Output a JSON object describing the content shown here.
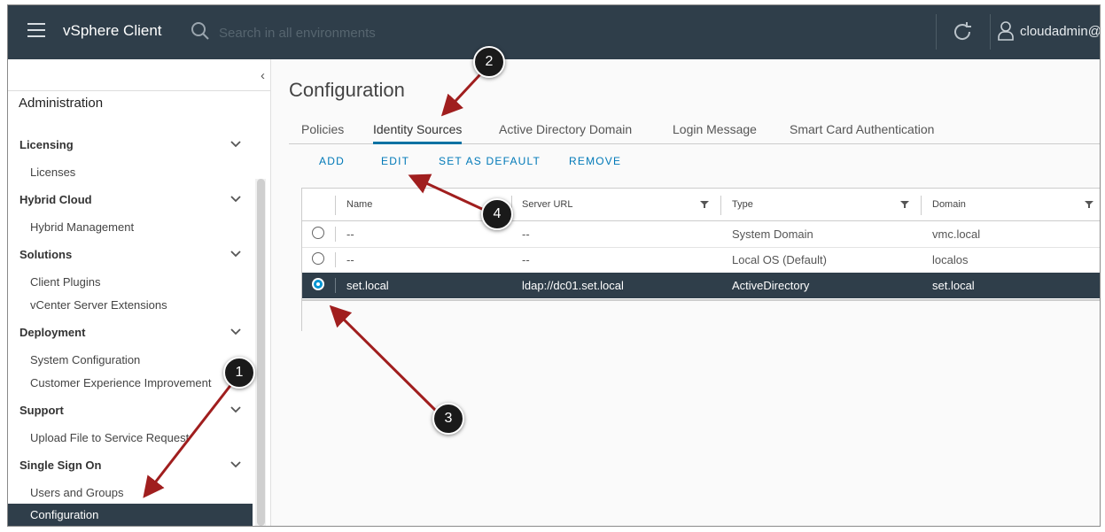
{
  "topbar": {
    "app_title": "vSphere Client",
    "search_placeholder": "Search in all environments",
    "user_name": "cloudadmin@"
  },
  "sidebar": {
    "heading": "Administration",
    "groups": [
      {
        "label": "Licensing",
        "items": [
          "Licenses"
        ]
      },
      {
        "label": "Hybrid Cloud",
        "items": [
          "Hybrid Management"
        ]
      },
      {
        "label": "Solutions",
        "items": [
          "Client Plugins",
          "vCenter Server Extensions"
        ]
      },
      {
        "label": "Deployment",
        "items": [
          "System Configuration",
          "Customer Experience Improvement"
        ]
      },
      {
        "label": "Support",
        "items": [
          "Upload File to Service Request"
        ]
      },
      {
        "label": "Single Sign On",
        "items": [
          "Users and Groups",
          "Configuration"
        ]
      }
    ]
  },
  "main": {
    "title": "Configuration",
    "tabs": [
      "Policies",
      "Identity Sources",
      "Active Directory Domain",
      "Login Message",
      "Smart Card Authentication"
    ],
    "active_tab": "Identity Sources",
    "actions": [
      "ADD",
      "EDIT",
      "SET AS DEFAULT",
      "REMOVE"
    ],
    "grid": {
      "columns": [
        "Name",
        "Server URL",
        "Type",
        "Domain"
      ],
      "rows": [
        {
          "name": "--",
          "server_url": "--",
          "type": "System Domain",
          "domain": "vmc.local",
          "selected": false
        },
        {
          "name": "--",
          "server_url": "--",
          "type": "Local OS (Default)",
          "domain": "localos",
          "selected": false
        },
        {
          "name": "set.local",
          "server_url": "ldap://dc01.set.local",
          "type": "ActiveDirectory",
          "domain": "set.local",
          "selected": true
        }
      ]
    }
  },
  "callouts": [
    "1",
    "2",
    "3",
    "4"
  ],
  "colors": {
    "header_bg": "#2f3e4a",
    "accent": "#0079b8",
    "arrow": "#a01e1e",
    "selected_row": "#2f3e4a"
  },
  "icons": [
    "menu-icon",
    "search-icon",
    "refresh-icon",
    "user-icon",
    "chevron-down-icon",
    "chevron-left-icon",
    "filter-icon"
  ]
}
